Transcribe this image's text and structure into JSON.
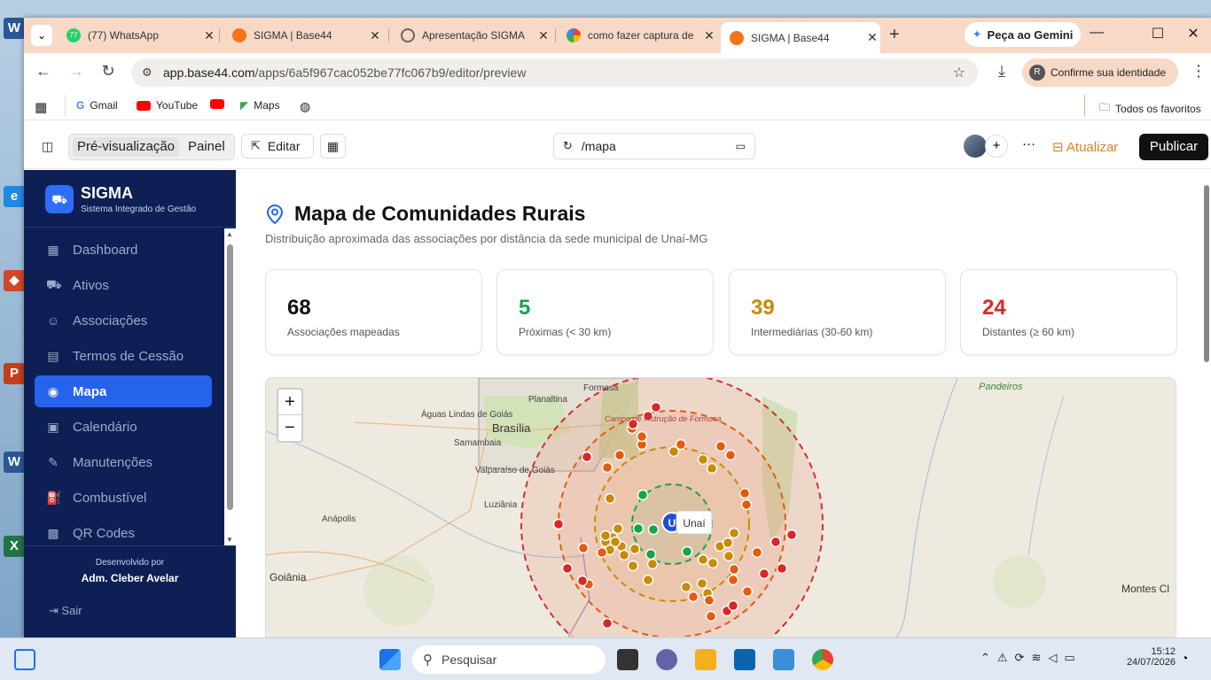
{
  "browser": {
    "tabs": [
      {
        "title": "(77) WhatsApp",
        "badge": "77"
      },
      {
        "title": "SIGMA | Base44"
      },
      {
        "title": "Apresentação SIGMA"
      },
      {
        "title": "como fazer captura de"
      },
      {
        "title": "SIGMA | Base44"
      }
    ],
    "gemini": "Peça ao Gemini",
    "url_host": "app.base44.com",
    "url_path": "/apps/6a5f967cac052be77fc067b9/editor/preview",
    "identity": "Confirme sua identidade",
    "identity_avatar": "R",
    "bookmarks": [
      "Gmail",
      "YouTube",
      "Maps"
    ],
    "all_bookmarks": "Todos os favoritos"
  },
  "editor": {
    "preview": "Pré-visualização",
    "panel": "Painel",
    "edit": "Editar",
    "route": "/mapa",
    "update": "Atualizar",
    "publish": "Publicar"
  },
  "sidebar": {
    "brand": "SIGMA",
    "subtitle": "Sistema Integrado de Gestão",
    "items": [
      {
        "label": "Dashboard",
        "icon": "grid-icon"
      },
      {
        "label": "Ativos",
        "icon": "tractor-icon"
      },
      {
        "label": "Associações",
        "icon": "users-icon"
      },
      {
        "label": "Termos de Cessão",
        "icon": "file-icon"
      },
      {
        "label": "Mapa",
        "icon": "map-pin-icon",
        "active": true
      },
      {
        "label": "Calendário",
        "icon": "calendar-icon"
      },
      {
        "label": "Manutenções",
        "icon": "wrench-icon"
      },
      {
        "label": "Combustível",
        "icon": "fuel-icon"
      },
      {
        "label": "QR Codes",
        "icon": "qr-icon"
      }
    ],
    "dev_label": "Desenvolvido por",
    "dev_name": "Adm. Cleber Avelar",
    "logout": "Sair"
  },
  "page": {
    "title": "Mapa de Comunidades Rurais",
    "subtitle": "Distribuição aproximada das associações por distância da sede municipal de Unaí-MG",
    "stats": [
      {
        "value": "68",
        "label": "Associações mapeadas",
        "color": "#111111"
      },
      {
        "value": "5",
        "label": "Próximas (< 30 km)",
        "color": "#16a34a"
      },
      {
        "value": "39",
        "label": "Intermediárias (30-60 km)",
        "color": "#ca8a04"
      },
      {
        "value": "24",
        "label": "Distantes (≥ 60 km)",
        "color": "#dc2626"
      }
    ]
  },
  "map": {
    "zoom_in": "+",
    "zoom_out": "−",
    "center_label": "Unaí",
    "center_marker": "U",
    "places": [
      "Formosa",
      "Planaltina",
      "Águas Lindas de Goiás",
      "Brasília",
      "Samambaia",
      "Valparaíso de Goiás",
      "Luziânia",
      "Anápolis",
      "Goiânia",
      "Pandeiros",
      "Montes Cl",
      "Campo de Instrução de Formosa"
    ]
  },
  "taskbar": {
    "search": "Pesquisar",
    "time": "15:12",
    "date": "24/07/2026"
  },
  "colors": {
    "sidebar_bg": "#0d1f55",
    "accent": "#2563eb",
    "near": "#16a34a",
    "mid": "#ca8a04",
    "far": "#dc2626"
  }
}
